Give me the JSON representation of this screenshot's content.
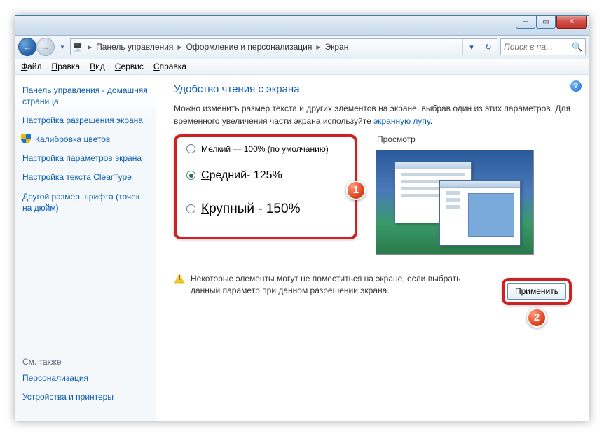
{
  "breadcrumbs": [
    "Панель управления",
    "Оформление и персонализация",
    "Экран"
  ],
  "search": {
    "placeholder": "Поиск в па..."
  },
  "menu": [
    "Файл",
    "Правка",
    "Вид",
    "Сервис",
    "Справка"
  ],
  "sidebar": {
    "items": [
      "Панель управления - домашняя страница",
      "Настройка разрешения экрана",
      "Калибровка цветов",
      "Настройка параметров экрана",
      "Настройка текста ClearType",
      "Другой размер шрифта (точек на дюйм)"
    ],
    "see_also_head": "См. также",
    "see_also": [
      "Персонализация",
      "Устройства и принтеры"
    ]
  },
  "main": {
    "heading": "Удобство чтения с экрана",
    "intro1": "Можно изменить размер текста и других элементов на экране, выбрав один из этих параметров. Для временного увеличения части экрана используйте ",
    "intro_link": "экранную лупу",
    "intro2": ".",
    "options": {
      "small": "Мелкий — 100% (по умолчанию)",
      "medium": "Средний- 125%",
      "large": "Крупный - 150%",
      "selected": "medium"
    },
    "preview_label": "Просмотр",
    "warning": "Некоторые элементы могут не поместиться на экране, если выбрать данный параметр при данном разрешении экрана.",
    "apply": "Применить"
  },
  "callouts": {
    "one": "1",
    "two": "2"
  }
}
